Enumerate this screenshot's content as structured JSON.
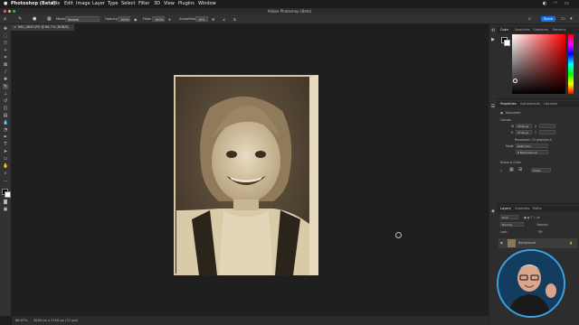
{
  "menubar": {
    "apple": "",
    "app_name": "Photoshop (Beta)",
    "items": [
      "File",
      "Edit",
      "Image",
      "Layer",
      "Type",
      "Select",
      "Filter",
      "3D",
      "View",
      "Plugins",
      "Window"
    ]
  },
  "window": {
    "title": "Adobe Photoshop (Beta)"
  },
  "options_bar": {
    "mode_label": "Mode:",
    "mode_value": "Normal",
    "opacity_label": "Opacity:",
    "opacity_value": "100%",
    "flow_label": "Flow:",
    "flow_value": "100%",
    "smoothing_label": "Smoothing:",
    "smoothing_value": "10%",
    "share_label": "Share"
  },
  "document": {
    "tab_label": "IMG_0843.JPG @ 66.7% (RGB/8)",
    "zoom": "66.67%",
    "size_info": "3000 px x 2100 px (72 ppi)"
  },
  "color_panel": {
    "tabs": [
      "Color",
      "Swatches",
      "Gradients",
      "Patterns"
    ],
    "foreground": "#000000",
    "background": "#ffffff"
  },
  "properties_panel": {
    "tabs": [
      "Properties",
      "Adjustments",
      "Libraries"
    ],
    "doc_label": "Document",
    "canvas_heading": "Canvas",
    "w_label": "W",
    "w_value": "3536 px",
    "h_label": "H",
    "h_value": "3746 px",
    "x_label": "X",
    "y_label": "Y",
    "resolution": "Resolution: 72 pixels/inch",
    "mode_label": "Mode",
    "mode_value": "RGB Color",
    "depth_value": "8 Bits/Channel",
    "rulers_heading": "Rulers & Grids",
    "ruler_units": "Pixels"
  },
  "layers_panel": {
    "tabs": [
      "Layers",
      "Channels",
      "Paths"
    ],
    "kind_label": "Kind",
    "blend_label": "Normal",
    "opacity_label": "Opacity:",
    "lock_label": "Lock:",
    "fill_label": "Fill:",
    "layer_name": "Background"
  },
  "colors": {
    "accent": "#1473e6",
    "canvas_bg": "#1f1f1f",
    "panel_bg": "#2d2d2d"
  }
}
